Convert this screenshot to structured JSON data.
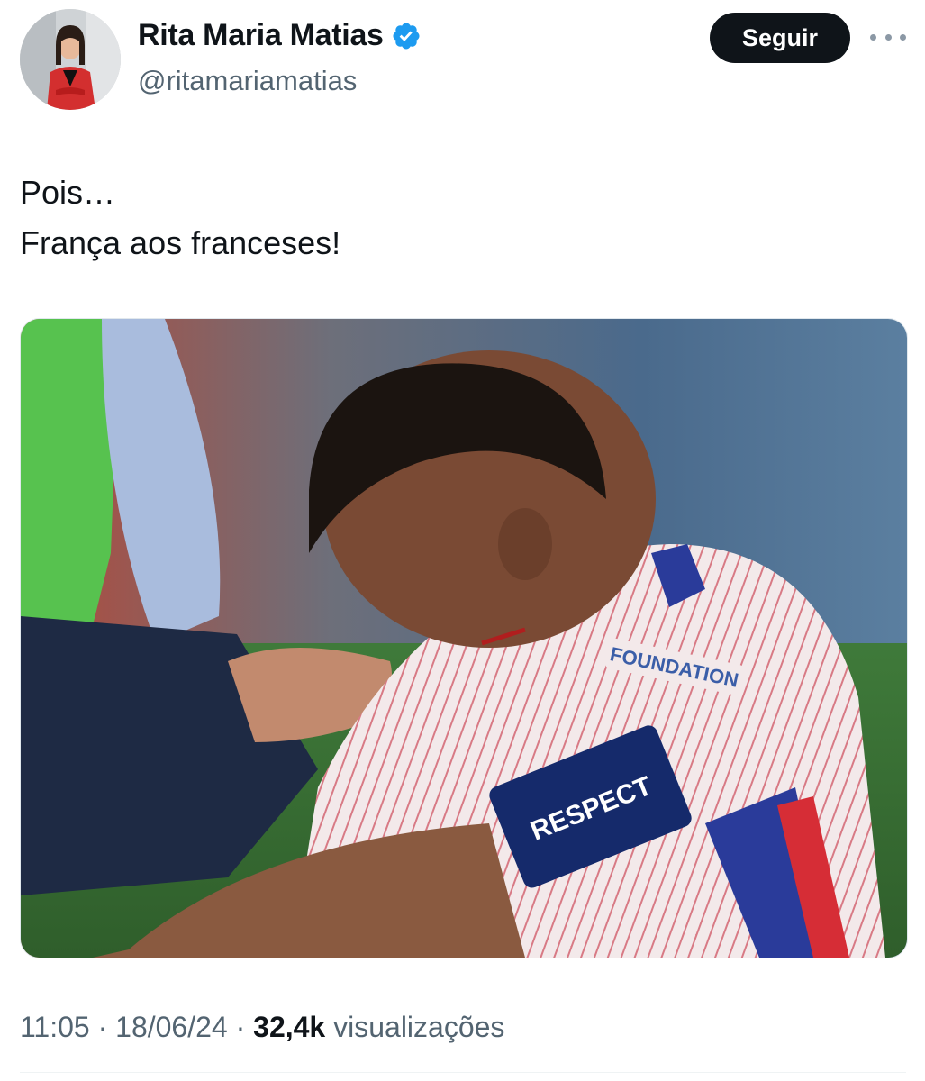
{
  "author": {
    "name": "Rita Maria Matias",
    "handle": "@ritamariamatias",
    "verified": true,
    "verified_color": "#1d9bf0"
  },
  "actions": {
    "follow_label": "Seguir",
    "more_icon": "more-horizontal-icon"
  },
  "tweet": {
    "lines": [
      "Pois…",
      "França aos franceses!"
    ]
  },
  "media": {
    "armband_text": "RESPECT",
    "patch_text": "FOUNDATION"
  },
  "meta": {
    "time": "11:05",
    "separator": "·",
    "date": "18/06/24",
    "views_count": "32,4k",
    "views_label": "visualizações"
  },
  "colors": {
    "text": "#0f1419",
    "secondary": "#536471",
    "button_bg": "#0f1419"
  }
}
